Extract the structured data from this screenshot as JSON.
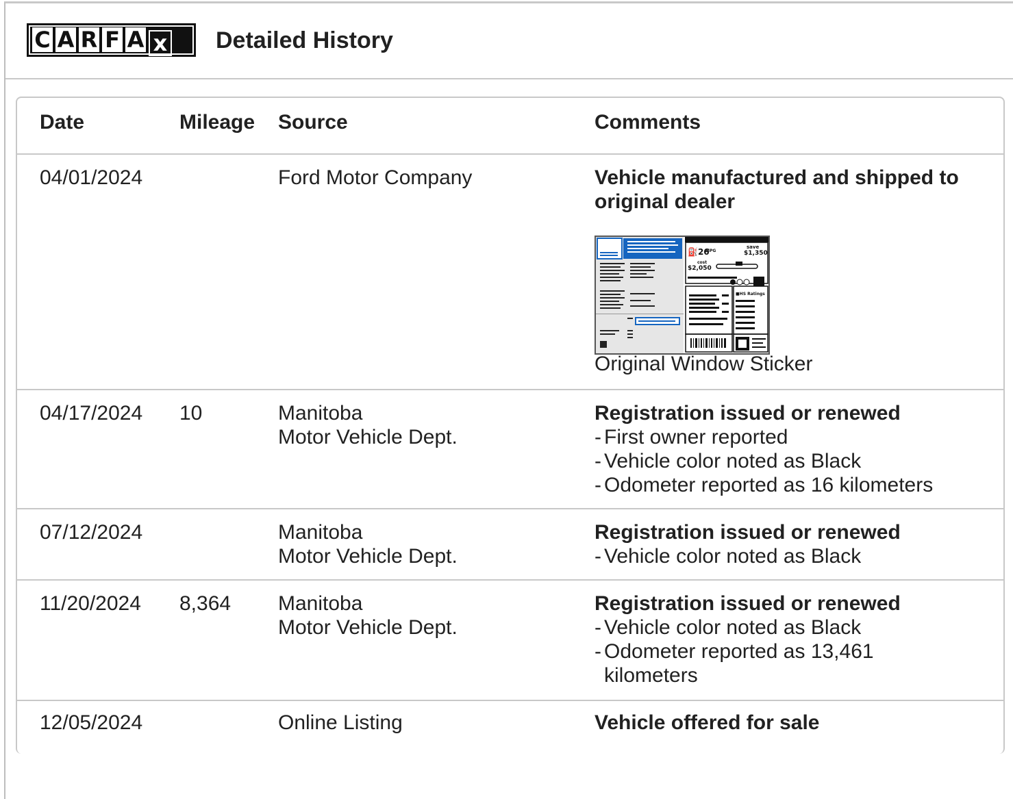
{
  "header": {
    "brand": "CARFAX",
    "title": "Detailed History"
  },
  "table": {
    "columns": {
      "date": "Date",
      "mileage": "Mileage",
      "source": "Source",
      "comments": "Comments"
    },
    "rows": [
      {
        "date": "04/01/2024",
        "mileage": "",
        "source_line1": "Ford Motor Company",
        "source_line2": "",
        "headline": "Vehicle manufactured and shipped to original dealer",
        "sticker_label": "Original Window Sticker",
        "sticker": {
          "mpg": "26",
          "mpg_unit": "MPG",
          "save_label": "save",
          "save": "$1,350",
          "cost_label": "cost",
          "cost": "$2,050",
          "ratings": "HS Ratings",
          "scale": "7"
        },
        "details": []
      },
      {
        "date": "04/17/2024",
        "mileage": "10",
        "source_line1": "Manitoba",
        "source_line2": "Motor Vehicle Dept.",
        "headline": "Registration issued or renewed",
        "details": [
          "First owner reported",
          "Vehicle color noted as Black",
          "Odometer reported as 16 kilometers"
        ]
      },
      {
        "date": "07/12/2024",
        "mileage": "",
        "source_line1": "Manitoba",
        "source_line2": "Motor Vehicle Dept.",
        "headline": "Registration issued or renewed",
        "details": [
          "Vehicle color noted as Black"
        ]
      },
      {
        "date": "11/20/2024",
        "mileage": "8,364",
        "source_line1": "Manitoba",
        "source_line2": "Motor Vehicle Dept.",
        "headline": "Registration issued or renewed",
        "details": [
          "Vehicle color noted as Black",
          "Odometer reported as 13,461 kilometers"
        ]
      },
      {
        "date": "12/05/2024",
        "mileage": "",
        "source_line1": "Online Listing",
        "source_line2": "",
        "headline": "Vehicle offered for sale",
        "details": []
      }
    ]
  },
  "colors": {
    "accent_blue": "#1565c0",
    "border": "#c8c8c8",
    "text": "#212121"
  }
}
